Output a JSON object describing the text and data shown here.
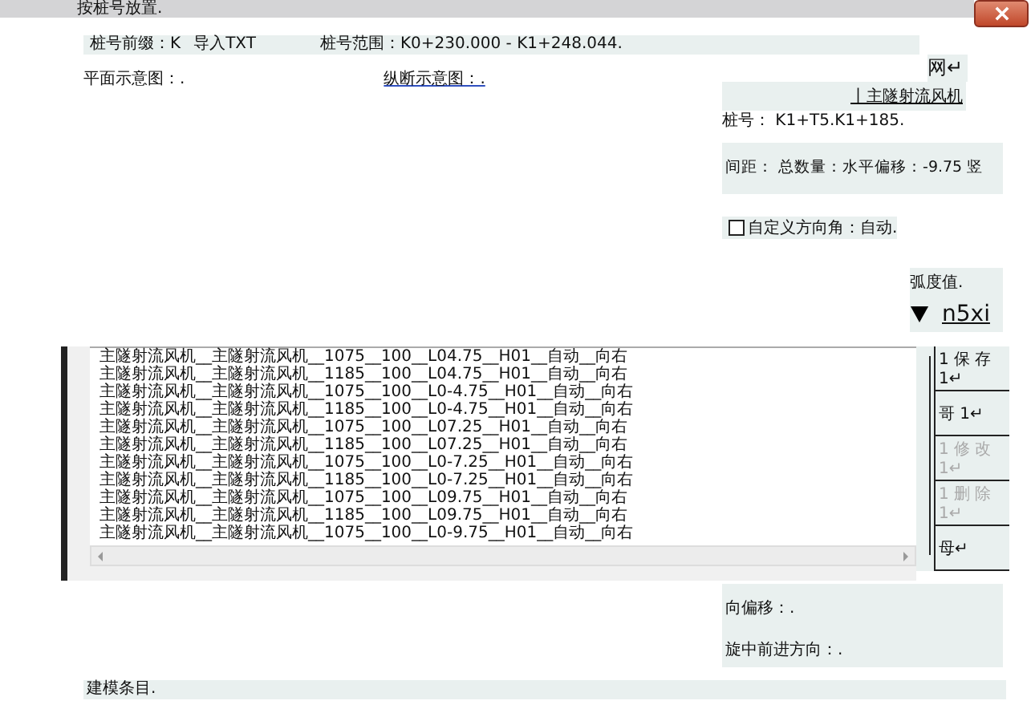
{
  "window": {
    "title": "按桩号放置."
  },
  "prefix_row": {
    "prefix": "桩号前缀：K",
    "import_button": "导入TXT",
    "range": "桩号范围：K0+230.000 - K1+248.044."
  },
  "views": [
    {
      "label": "平面示意图：.",
      "kind": "plain"
    },
    {
      "label": "纵断示意图：.",
      "kind": "link"
    }
  ],
  "grid_mark": "网↵",
  "right_panel": {
    "heading": "丨主隧射流风机",
    "station": "桩号： K1+T5.K1+185.",
    "spacing": "间距： 总数量：水平偏移：-9.75 竖",
    "custom_angle": {
      "label": "自定义方向角：自动.",
      "checked": false
    },
    "radian": "弧度值.",
    "dropdown": "n5xi"
  },
  "side_buttons": [
    {
      "label": "1 保 存 1↵",
      "disabled": false
    },
    {
      "label": "哥 1↵",
      "disabled": false
    },
    {
      "label": "1 修 改 1↵",
      "disabled": true
    },
    {
      "label": "1 删 除 1↵",
      "disabled": true
    },
    {
      "label": "母↵",
      "disabled": false
    }
  ],
  "list": {
    "rows": [
      "主隧射流风机__主隧射流风机__1075__100__L04.75__H01__自动__向右",
      "主隧射流风机__主隧射流风机__1185__100__L04.75__H01__自动__向右",
      "主隧射流风机__主隧射流风机__1075__100__L0-4.75__H01__自动__向右",
      "主隧射流风机__主隧射流风机__1185__100__L0-4.75__H01__自动__向右",
      "主隧射流风机__主隧射流风机__1075__100__L07.25__H01__自动__向右",
      "主隧射流风机__主隧射流风机__1185__100__L07.25__H01__自动__向右",
      "主隧射流风机__主隧射流风机__1075__100__L0-7.25__H01__自动__向右",
      "主隧射流风机__主隧射流风机__1185__100__L0-7.25__H01__自动__向右",
      "主隧射流风机__主隧射流风机__1075__100__L09.75__H01__自动__向右",
      "主隧射流风机__主隧射流风机__1185__100__L09.75__H01__自动__向右",
      "主隧射流风机__主隧射流风机__1075__100__L0-9.75__H01__自动__向右"
    ]
  },
  "bottom_panel": {
    "offset": "向偏移：.",
    "direction": "旋中前进方向：."
  },
  "modeling": "建模条目."
}
